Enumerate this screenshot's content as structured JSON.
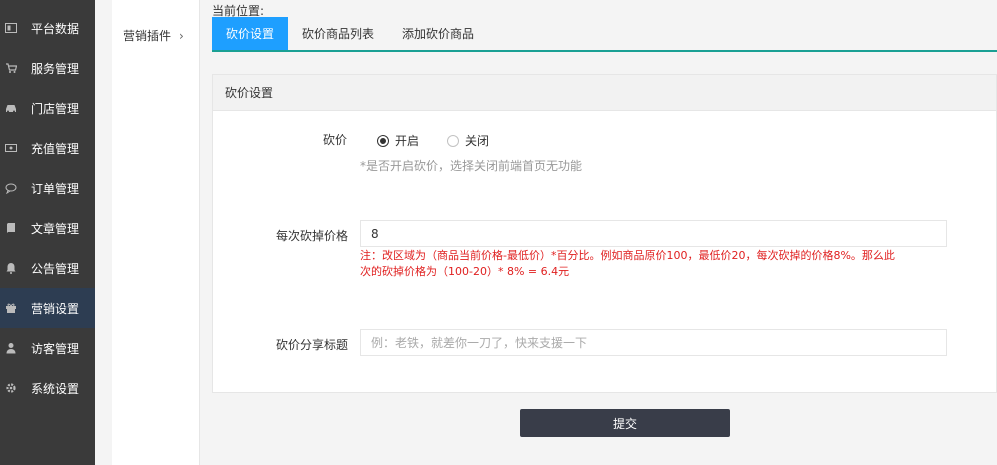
{
  "sidebar": {
    "items": [
      {
        "label": "平台数据",
        "icon": "dashboard-icon",
        "active": false
      },
      {
        "label": "服务管理",
        "icon": "cart-icon",
        "active": false
      },
      {
        "label": "门店管理",
        "icon": "car-icon",
        "active": false
      },
      {
        "label": "充值管理",
        "icon": "wallet-icon",
        "active": false
      },
      {
        "label": "订单管理",
        "icon": "chat-bubble-icon",
        "active": false
      },
      {
        "label": "文章管理",
        "icon": "book-icon",
        "active": false
      },
      {
        "label": "公告管理",
        "icon": "bell-icon",
        "active": false
      },
      {
        "label": "营销设置",
        "icon": "gift-icon",
        "active": true
      },
      {
        "label": "访客管理",
        "icon": "user-icon",
        "active": false
      },
      {
        "label": "系统设置",
        "icon": "gear-icon",
        "active": false
      }
    ]
  },
  "submenu": {
    "label": "营销插件",
    "chevron": "›"
  },
  "breadcrumb": "当前位置:",
  "tabs": [
    {
      "label": "砍价设置",
      "active": true
    },
    {
      "label": "砍价商品列表",
      "active": false
    },
    {
      "label": "添加砍价商品",
      "active": false
    }
  ],
  "panel": {
    "title": "砍价设置",
    "bargain": {
      "label": "砍价",
      "options": [
        {
          "label": "开启",
          "checked": true
        },
        {
          "label": "关闭",
          "checked": false
        }
      ],
      "hint": "*是否开启砍价，选择关闭前端首页无功能"
    },
    "cut_price": {
      "label": "每次砍掉价格",
      "value": "8",
      "note_line1": "注：改区域为（商品当前价格-最低价）*百分比。例如商品原价100，最低价20，每次砍掉的价格8%。那么此",
      "note_line2": "次的砍掉价格为（100-20）* 8% = 6.4元"
    },
    "share_title": {
      "label": "砍价分享标题",
      "value": "",
      "placeholder": "例：老铁，就差你一刀了，快来支援一下"
    }
  },
  "submit_label": "提交",
  "colors": {
    "sidebar_bg": "#3a3a3a",
    "sidebar_active": "#2d3d52",
    "tab_active": "#1e9fff",
    "tab_underline": "#1aa094",
    "warning": "#e02020",
    "submit_bg": "#393d49"
  }
}
